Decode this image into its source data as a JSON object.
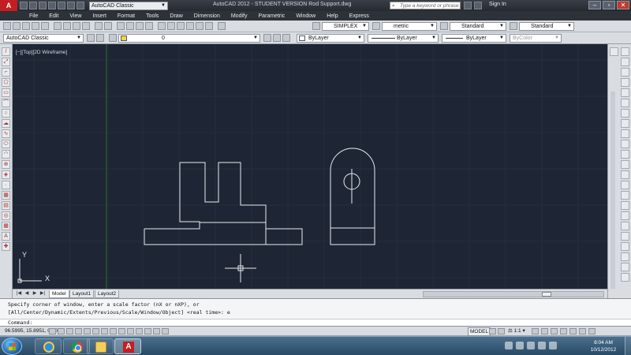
{
  "window": {
    "title": "AutoCAD 2012 - STUDENT VERSION    Rod Support.dwg",
    "workspace": "AutoCAD Classic",
    "search_placeholder": "Type a keyword or phrase",
    "sign_in": "Sign In"
  },
  "menu": [
    "File",
    "Edit",
    "View",
    "Insert",
    "Format",
    "Tools",
    "Draw",
    "Dimension",
    "Modify",
    "Parametric",
    "Window",
    "Help",
    "Express"
  ],
  "styles_toolbar": {
    "text_style": "SIMPLEX",
    "dim_style": "metric",
    "table_style": "Standard",
    "multileader_style": "Standard"
  },
  "layers_toolbar": {
    "workspace": "AutoCAD Classic",
    "layer": "0",
    "color": "ByLayer",
    "linetype": "ByLayer",
    "lineweight": "ByLayer",
    "plot_style": "ByColor"
  },
  "viewport": {
    "label": "[−][Top][2D Wireframe]",
    "ucs_x": "X",
    "ucs_y": "Y"
  },
  "layout_tabs": [
    "Model",
    "Layout1",
    "Layout2"
  ],
  "command": {
    "history_line1": "Specify corner of window, enter a scale factor (nX or nXP), or",
    "history_line2": "[All/Center/Dynamic/Extents/Previous/Scale/Window/Object] <real time>: e",
    "prompt": "Command:"
  },
  "status": {
    "coordinates": "96.5995, 15.8951, 0.0000",
    "model": "MODEL",
    "scale": "1:1"
  },
  "taskbar": {
    "apps": [
      "internet-explorer",
      "chrome",
      "windows-explorer",
      "autocad"
    ],
    "time": "8:04 AM",
    "date": "10/12/2012"
  },
  "colors": {
    "canvas_background": "#1e2635",
    "geometry_stroke": "#e8ecef",
    "grid_line": "#2a3443",
    "title_bar": "#2d3238",
    "autocad_red": "#c41d22"
  }
}
